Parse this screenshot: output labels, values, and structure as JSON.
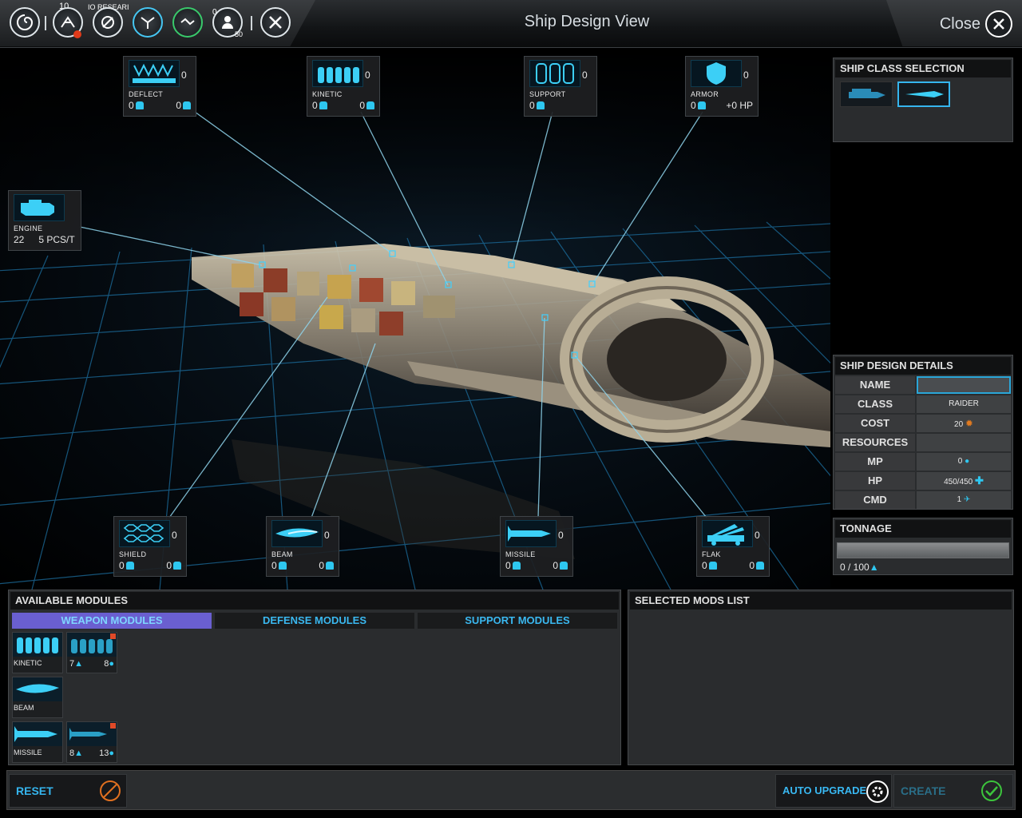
{
  "window": {
    "title": "Ship Design View",
    "close_label": "Close"
  },
  "topbar": {
    "research_count": "10",
    "research_label": "IO RESEARI",
    "badge_a": "0",
    "badge_b": "50",
    "icons": [
      "empire-icon",
      "research-icon",
      "science-icon",
      "shipyard-icon",
      "diplomacy-icon",
      "population-icon",
      "settings-icon"
    ]
  },
  "slots": {
    "deflect": {
      "label": "DEFLECT",
      "count": "0",
      "a": "0",
      "b": "0"
    },
    "kinetic": {
      "label": "KINETIC",
      "count": "0",
      "a": "0",
      "b": "0"
    },
    "support": {
      "label": "SUPPORT",
      "count": "0",
      "a": "0"
    },
    "armor": {
      "label": "ARMOR",
      "count": "0",
      "a": "0",
      "b": "+0 HP"
    },
    "engine": {
      "label": "ENGINE",
      "a": "22",
      "b": "5 PCS/T"
    },
    "shield": {
      "label": "SHIELD",
      "count": "0",
      "a": "0",
      "b": "0"
    },
    "beam": {
      "label": "BEAM",
      "count": "0",
      "a": "0",
      "b": "0"
    },
    "missile": {
      "label": "MISSILE",
      "count": "0",
      "a": "0",
      "b": "0"
    },
    "flak": {
      "label": "FLAK",
      "count": "0",
      "a": "0",
      "b": "0"
    }
  },
  "ship_class": {
    "title": "SHIP CLASS SELECTION"
  },
  "details": {
    "title": "SHIP DESIGN DETAILS",
    "name_label": "NAME",
    "name_value": "",
    "class_label": "CLASS",
    "class_value": "RAIDER",
    "cost_label": "COST",
    "cost_value": "20",
    "resources_label": "RESOURCES",
    "resources_value": "",
    "mp_label": "MP",
    "mp_value": "0",
    "hp_label": "HP",
    "hp_value": "450/450",
    "cmd_label": "CMD",
    "cmd_value": "1"
  },
  "tonnage": {
    "title": "TONNAGE",
    "value": "0 / 100",
    "fill": 0
  },
  "modules": {
    "title": "AVAILABLE MODULES",
    "tabs": [
      "WEAPON MODULES",
      "DEFENSE MODULES",
      "SUPPORT MODULES"
    ],
    "items": {
      "kinetic_label": "KINETIC",
      "kinetic2_a": "7",
      "kinetic2_b": "8",
      "beam_label": "BEAM",
      "missile_label": "MISSILE",
      "missile2_a": "8",
      "missile2_b": "13"
    }
  },
  "selected": {
    "title": "SELECTED MODS LIST"
  },
  "actions": {
    "reset": "RESET",
    "auto_upgrade": "AUTO UPGRADE",
    "create": "CREATE"
  },
  "colors": {
    "accent": "#35b5ee",
    "tab_active": "#6a5fd0",
    "confirm": "#3cc43c",
    "reset": "#e07020"
  }
}
